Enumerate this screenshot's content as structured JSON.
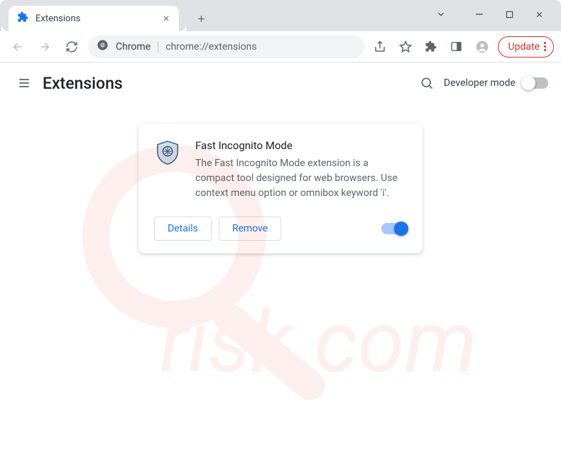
{
  "window": {
    "tab_title": "Extensions"
  },
  "addressbar": {
    "chip": "Chrome",
    "url": "chrome://extensions"
  },
  "toolbar": {
    "update_label": "Update"
  },
  "page": {
    "title": "Extensions",
    "developer_mode_label": "Developer mode",
    "developer_mode_on": false
  },
  "extension": {
    "name": "Fast Incognito Mode",
    "description": "The Fast Incognito Mode extension is a compact tool designed for web browsers. Use context menu option or omnibox keyword 'i'.",
    "details_label": "Details",
    "remove_label": "Remove",
    "enabled": true
  },
  "colors": {
    "accent": "#1a73e8",
    "danger": "#d93025"
  }
}
